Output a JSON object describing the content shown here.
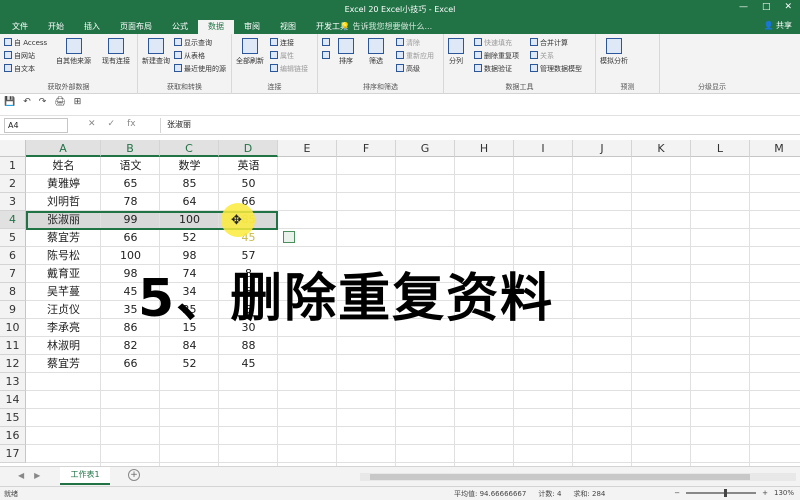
{
  "window": {
    "title": "Excel 20  Excel小技巧 - Excel",
    "controls": [
      "—",
      "□",
      "✕"
    ],
    "search_placeholder": "告诉我您想要做什么...",
    "share": "共享"
  },
  "tabs": [
    "文件",
    "开始",
    "插入",
    "页面布局",
    "公式",
    "数据",
    "审阅",
    "视图",
    "开发工具"
  ],
  "active_tab": "数据",
  "ribbon": {
    "get_external": {
      "label": "获取外部数据",
      "items": [
        "自 Access",
        "自网站",
        "自文本",
        "自其他来源",
        "现有连接"
      ]
    },
    "get_transform": {
      "label": "获取和转换",
      "items": [
        "新建查询",
        "显示查询",
        "从表格",
        "最近使用的源"
      ]
    },
    "connections": {
      "label": "连接",
      "items": [
        "全部刷新",
        "连接",
        "属性",
        "编辑链接"
      ]
    },
    "sort_filter": {
      "label": "排序和筛选",
      "items": [
        "排序",
        "筛选",
        "清除",
        "重新应用",
        "高级"
      ]
    },
    "data_tools": {
      "label": "数据工具",
      "items": [
        "分列",
        "快速填充",
        "删除重复项",
        "数据验证",
        "合并计算",
        "关系",
        "管理数据模型"
      ]
    },
    "forecast": {
      "label": "预测",
      "items": [
        "模拟分析"
      ]
    },
    "outline": {
      "label": "分级显示"
    }
  },
  "qat": [
    "💾",
    "↶",
    "↷",
    "🖨",
    "⊞"
  ],
  "formula_bar": {
    "name_box": "A4",
    "fx": "fx",
    "cancel": "✕",
    "confirm": "✓",
    "content": "张淑丽"
  },
  "columns": [
    "A",
    "B",
    "C",
    "D",
    "E",
    "F",
    "G",
    "H",
    "I",
    "J",
    "K",
    "L",
    "M"
  ],
  "rows": [
    "1",
    "2",
    "3",
    "4",
    "5",
    "6",
    "7",
    "8",
    "9",
    "10",
    "11",
    "12",
    "13",
    "14",
    "15",
    "16",
    "17"
  ],
  "table": [
    [
      "姓名",
      "语文",
      "数学",
      "英语"
    ],
    [
      "黄雅婷",
      "65",
      "85",
      "50"
    ],
    [
      "刘明哲",
      "78",
      "64",
      "66"
    ],
    [
      "张淑丽",
      "99",
      "100",
      "85"
    ],
    [
      "蔡宜芳",
      "66",
      "52",
      "45"
    ],
    [
      "陈号松",
      "100",
      "98",
      "57"
    ],
    [
      "戴育亚",
      "98",
      "74",
      "8"
    ],
    [
      "吴芊蔓",
      "45",
      "34",
      "8"
    ],
    [
      "汪贞仪",
      "35",
      "25",
      "8"
    ],
    [
      "李承亮",
      "86",
      "15",
      "30"
    ],
    [
      "林淑明",
      "82",
      "84",
      "88"
    ],
    [
      "蔡宜芳",
      "66",
      "52",
      "45"
    ]
  ],
  "overlay_text": "5、删除重复资料",
  "sheet_tab": "工作表1",
  "status": {
    "ready": "就绪",
    "average": "平均值: 94.66666667",
    "count": "计数: 4",
    "sum": "求和: 284",
    "zoom": "130%"
  }
}
